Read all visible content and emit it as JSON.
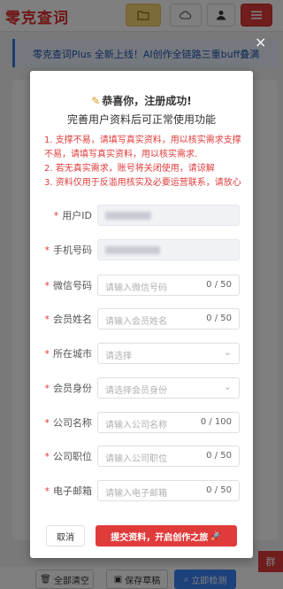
{
  "background": {
    "logo": "零克查词",
    "notice_text": "零克查词Plus 全新上线！AI创作全链路三重buff叠满",
    "notice_close": "×",
    "bottom_buttons": {
      "clear": "全部清空",
      "save": "保存草稿",
      "detect": "立即检测"
    },
    "side_tab": "群"
  },
  "modal": {
    "title": "恭喜你，注册成功!",
    "subtitle": "完善用户资料后可正常使用功能",
    "notes": [
      "1. 支撑不易，请填写真实资料，用以核实需求支撑不易，请填写真实资料，用以核实需求.",
      "2. 若无真实需求，账号将关闭使用，请谅解",
      "3. 资料仅用于反滥用核实及必要运营联系，请放心"
    ],
    "fields": [
      {
        "label": "用户ID",
        "value": "",
        "count": "",
        "type": "readonly"
      },
      {
        "label": "手机号码",
        "value": "",
        "count": "",
        "type": "readonly"
      },
      {
        "label": "微信号码",
        "placeholder": "请输入微信号码",
        "count": "0 / 50",
        "type": "input"
      },
      {
        "label": "会员姓名",
        "placeholder": "请输入会员姓名",
        "count": "0 / 50",
        "type": "input"
      },
      {
        "label": "所在城市",
        "placeholder": "请选择",
        "count": "",
        "type": "select"
      },
      {
        "label": "会员身份",
        "placeholder": "请选择会员身份",
        "count": "",
        "type": "select"
      },
      {
        "label": "公司名称",
        "placeholder": "请输入公司名称",
        "count": "0 / 100",
        "type": "input"
      },
      {
        "label": "公司职位",
        "placeholder": "请输入公司职位",
        "count": "0 / 50",
        "type": "input"
      },
      {
        "label": "电子邮箱",
        "placeholder": "请输入电子邮箱",
        "count": "0 / 50",
        "type": "input"
      }
    ],
    "required_mark": "*",
    "cancel_label": "取消",
    "submit_label": "提交资料，开启创作之旅"
  },
  "icons": {
    "pencil": "pencil-icon",
    "rocket": "rocket-icon",
    "folder": "folder-icon",
    "cloud": "cloud-icon",
    "user": "user-icon",
    "menu": "menu-icon",
    "chevron": "chevron-down-icon"
  },
  "colors": {
    "brand_red": "#e03b3b",
    "notice_blue": "#3b7ddd",
    "folder_yellow": "#f7d774"
  }
}
